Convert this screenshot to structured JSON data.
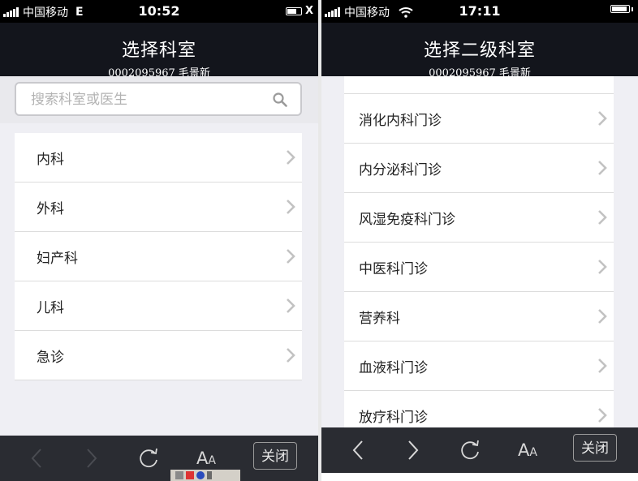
{
  "left": {
    "status": {
      "carrier": "中国移动",
      "network": "E",
      "time": "10:52",
      "x": "X"
    },
    "nav": {
      "title": "选择科室",
      "subtitle": "0002095967  毛景新"
    },
    "search": {
      "placeholder": "搜索科室或医生",
      "value": ""
    },
    "items": [
      "内科",
      "外科",
      "妇产科",
      "儿科",
      "急诊"
    ],
    "toolbar": {
      "aa": "A",
      "aa_small": "A",
      "close": "关闭"
    }
  },
  "right": {
    "status": {
      "carrier": "中国移动",
      "time": "17:11"
    },
    "nav": {
      "title": "选择二级科室",
      "subtitle": "0002095967  毛景新"
    },
    "items": [
      "消化内科门诊",
      "内分泌科门诊",
      "风湿免疫科门诊",
      "中医科门诊",
      "营养科",
      "血液科门诊",
      "放疗科门诊"
    ],
    "toolbar": {
      "aa": "A",
      "aa_small": "A",
      "close": "关闭"
    }
  },
  "colors": {
    "navbar": "#13151c",
    "toolbar": "#2a2c32",
    "background": "#efeff4"
  },
  "icons": [
    "signal-icon",
    "wifi-icon",
    "battery-icon",
    "search-icon",
    "chevron-right-icon",
    "back-icon",
    "forward-icon",
    "refresh-icon",
    "font-size-icon"
  ]
}
